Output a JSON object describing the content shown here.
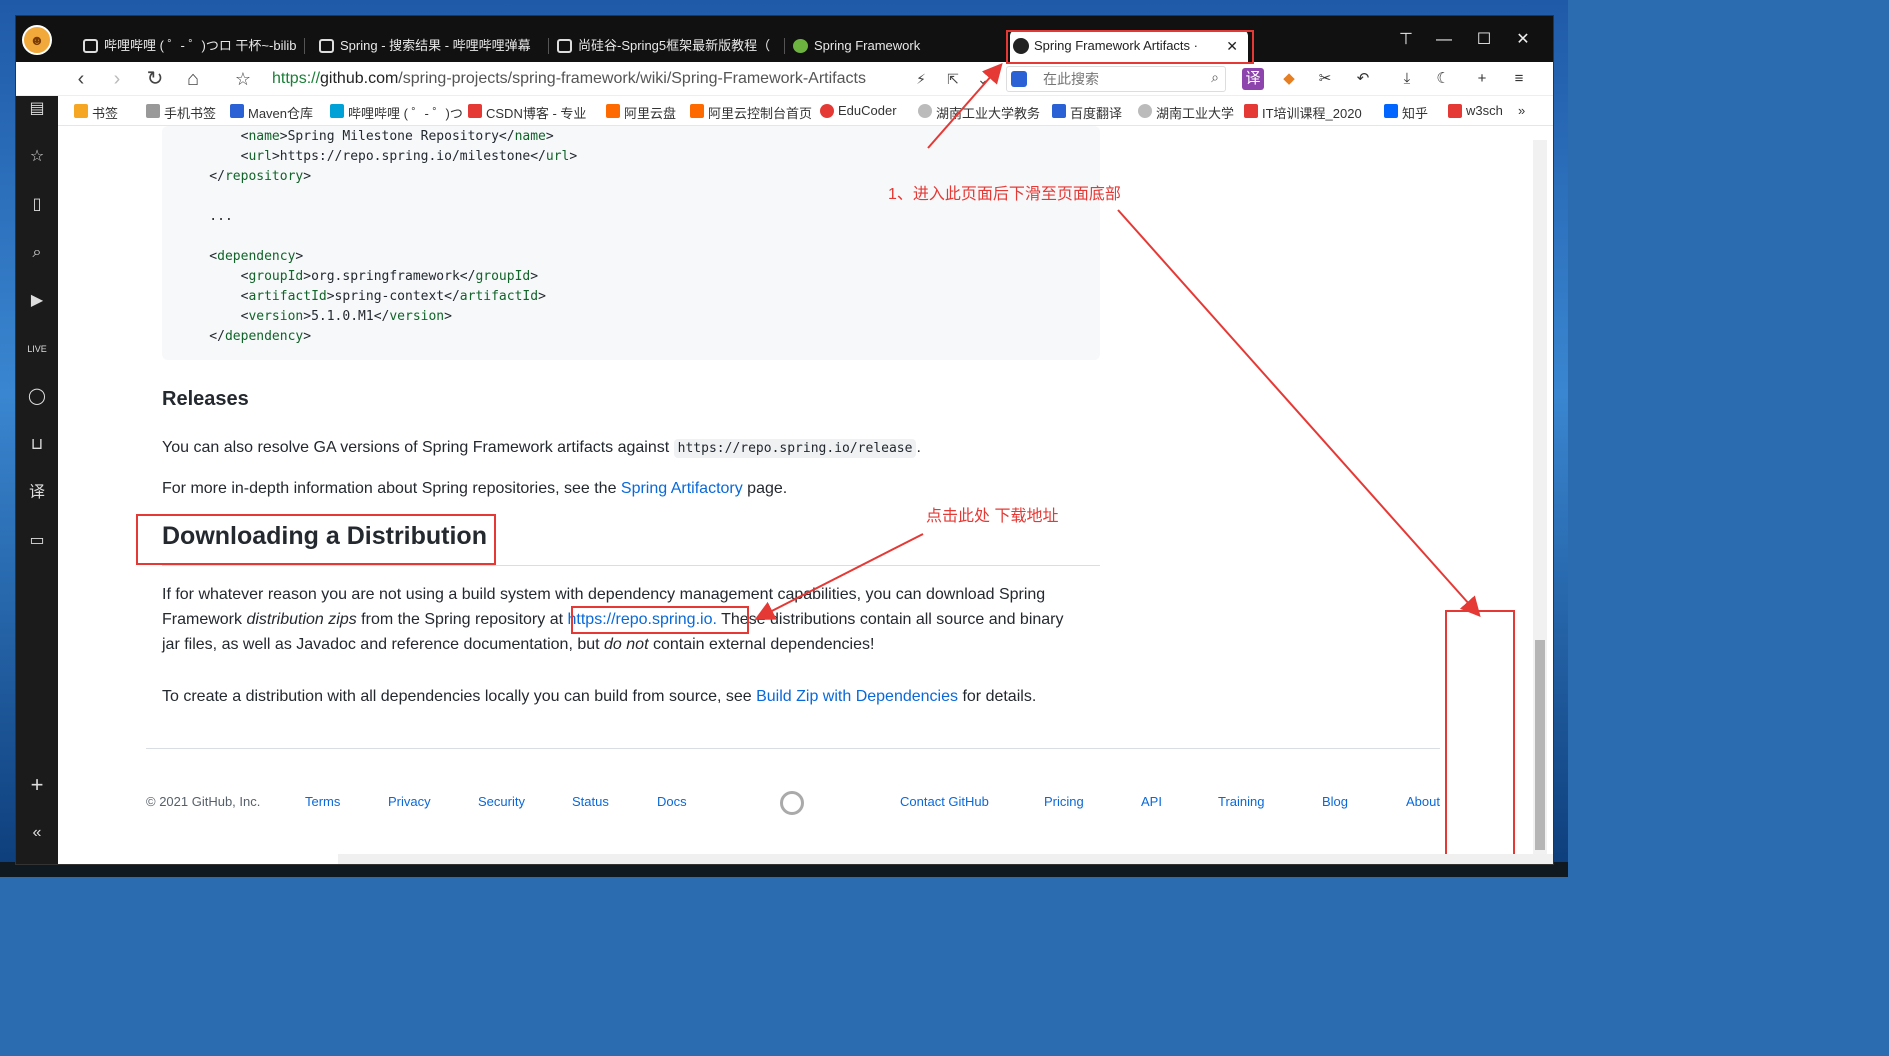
{
  "tabs": [
    {
      "label": "哔哩哔哩 ( ゜- ゜)つロ 干杯~-bilib",
      "active": false
    },
    {
      "label": "Spring - 搜索结果 - 哔哩哔哩弹幕",
      "active": false
    },
    {
      "label": "尚硅谷-Spring5框架最新版教程（",
      "active": false
    },
    {
      "label": "Spring Framework",
      "active": false
    },
    {
      "label": "Spring Framework Artifacts ·",
      "active": true
    }
  ],
  "tab_close": "✕",
  "window_controls": {
    "minimize": "—",
    "maximize": "☐",
    "close": "✕"
  },
  "address": {
    "scheme": "https://",
    "host": "github.com",
    "path": "/spring-projects/spring-framework/wiki/Spring-Framework-Artifacts"
  },
  "search": {
    "placeholder": "在此搜索"
  },
  "bookmarks": [
    {
      "label": "书签",
      "color": "#f5a623"
    },
    {
      "label": "手机书签",
      "color": "#888888"
    },
    {
      "label": "Maven仓库",
      "color": "#2a62d6"
    },
    {
      "label": "哔哩哔哩 ( ゜- ゜)つ",
      "color": "#00a1d6"
    },
    {
      "label": "CSDN博客 - 专业",
      "color": "#e53935"
    },
    {
      "label": "阿里云盘",
      "color": "#ff6a00"
    },
    {
      "label": "阿里云控制台首页",
      "color": "#ff6a00"
    },
    {
      "label": "EduCoder",
      "color": "#e53935"
    },
    {
      "label": "湖南工业大学教务",
      "color": "#777777"
    },
    {
      "label": "百度翻译",
      "color": "#2a62d6"
    },
    {
      "label": "湖南工业大学",
      "color": "#777777"
    },
    {
      "label": "IT培训课程_2020",
      "color": "#e53935"
    },
    {
      "label": "知乎",
      "color": "#0066ff"
    },
    {
      "label": "w3sch",
      "color": "#e53935"
    }
  ],
  "bookmarks_more": "»",
  "code_lines": [
    {
      "indent": 2,
      "tag": "name",
      "text": "Spring Milestone Repository"
    },
    {
      "indent": 2,
      "tag": "url",
      "text": "https://repo.spring.io/milestone"
    },
    {
      "indent": 1,
      "close": "repository"
    },
    {
      "indent": 0,
      "blank": true
    },
    {
      "indent": 1,
      "plain": "..."
    },
    {
      "indent": 0,
      "blank": true
    },
    {
      "indent": 1,
      "open": "dependency"
    },
    {
      "indent": 2,
      "tag": "groupId",
      "text": "org.springframework"
    },
    {
      "indent": 2,
      "tag": "artifactId",
      "text": "spring-context"
    },
    {
      "indent": 2,
      "tag": "version",
      "text": "5.1.0.M1"
    },
    {
      "indent": 1,
      "close": "dependency"
    }
  ],
  "releases": {
    "heading": "Releases",
    "p1_before": "You can also resolve GA versions of Spring Framework artifacts against ",
    "p1_code": "https://repo.spring.io/release",
    "p1_after": ".",
    "p2_before": "For more in-depth information about Spring repositories, see the ",
    "p2_link": "Spring Artifactory",
    "p2_after": " page."
  },
  "download": {
    "heading": "Downloading a Distribution",
    "p1_a": "If for whatever reason you are not using a build system with dependency management capabilities, you can download Spring",
    "p1_b1": "Framework ",
    "p1_b_em": "distribution zips",
    "p1_b2": " from the Spring repository at ",
    "p1_link": "https://repo.spring.io.",
    "p1_b3": " These distributions contain all source and binary",
    "p1_c1": "jar files, as well as Javadoc and reference documentation, but ",
    "p1_c_em": "do not",
    "p1_c2": " contain external dependencies!",
    "p2_before": "To create a distribution with all dependencies locally you can build from source, see ",
    "p2_link": "Build Zip with Dependencies",
    "p2_after": " for details."
  },
  "footer": {
    "copyright": "© 2021 GitHub, Inc.",
    "links_left": [
      "Terms",
      "Privacy",
      "Security",
      "Status",
      "Docs"
    ],
    "links_right": [
      "Contact GitHub",
      "Pricing",
      "API",
      "Training",
      "Blog",
      "About"
    ]
  },
  "annotations": {
    "step1": "1、进入此页面后下滑至页面底部",
    "step2": "点击此处  下载地址"
  },
  "colors": {
    "accent": "#0969da",
    "annotation": "#e53935",
    "tag": "#116329"
  }
}
